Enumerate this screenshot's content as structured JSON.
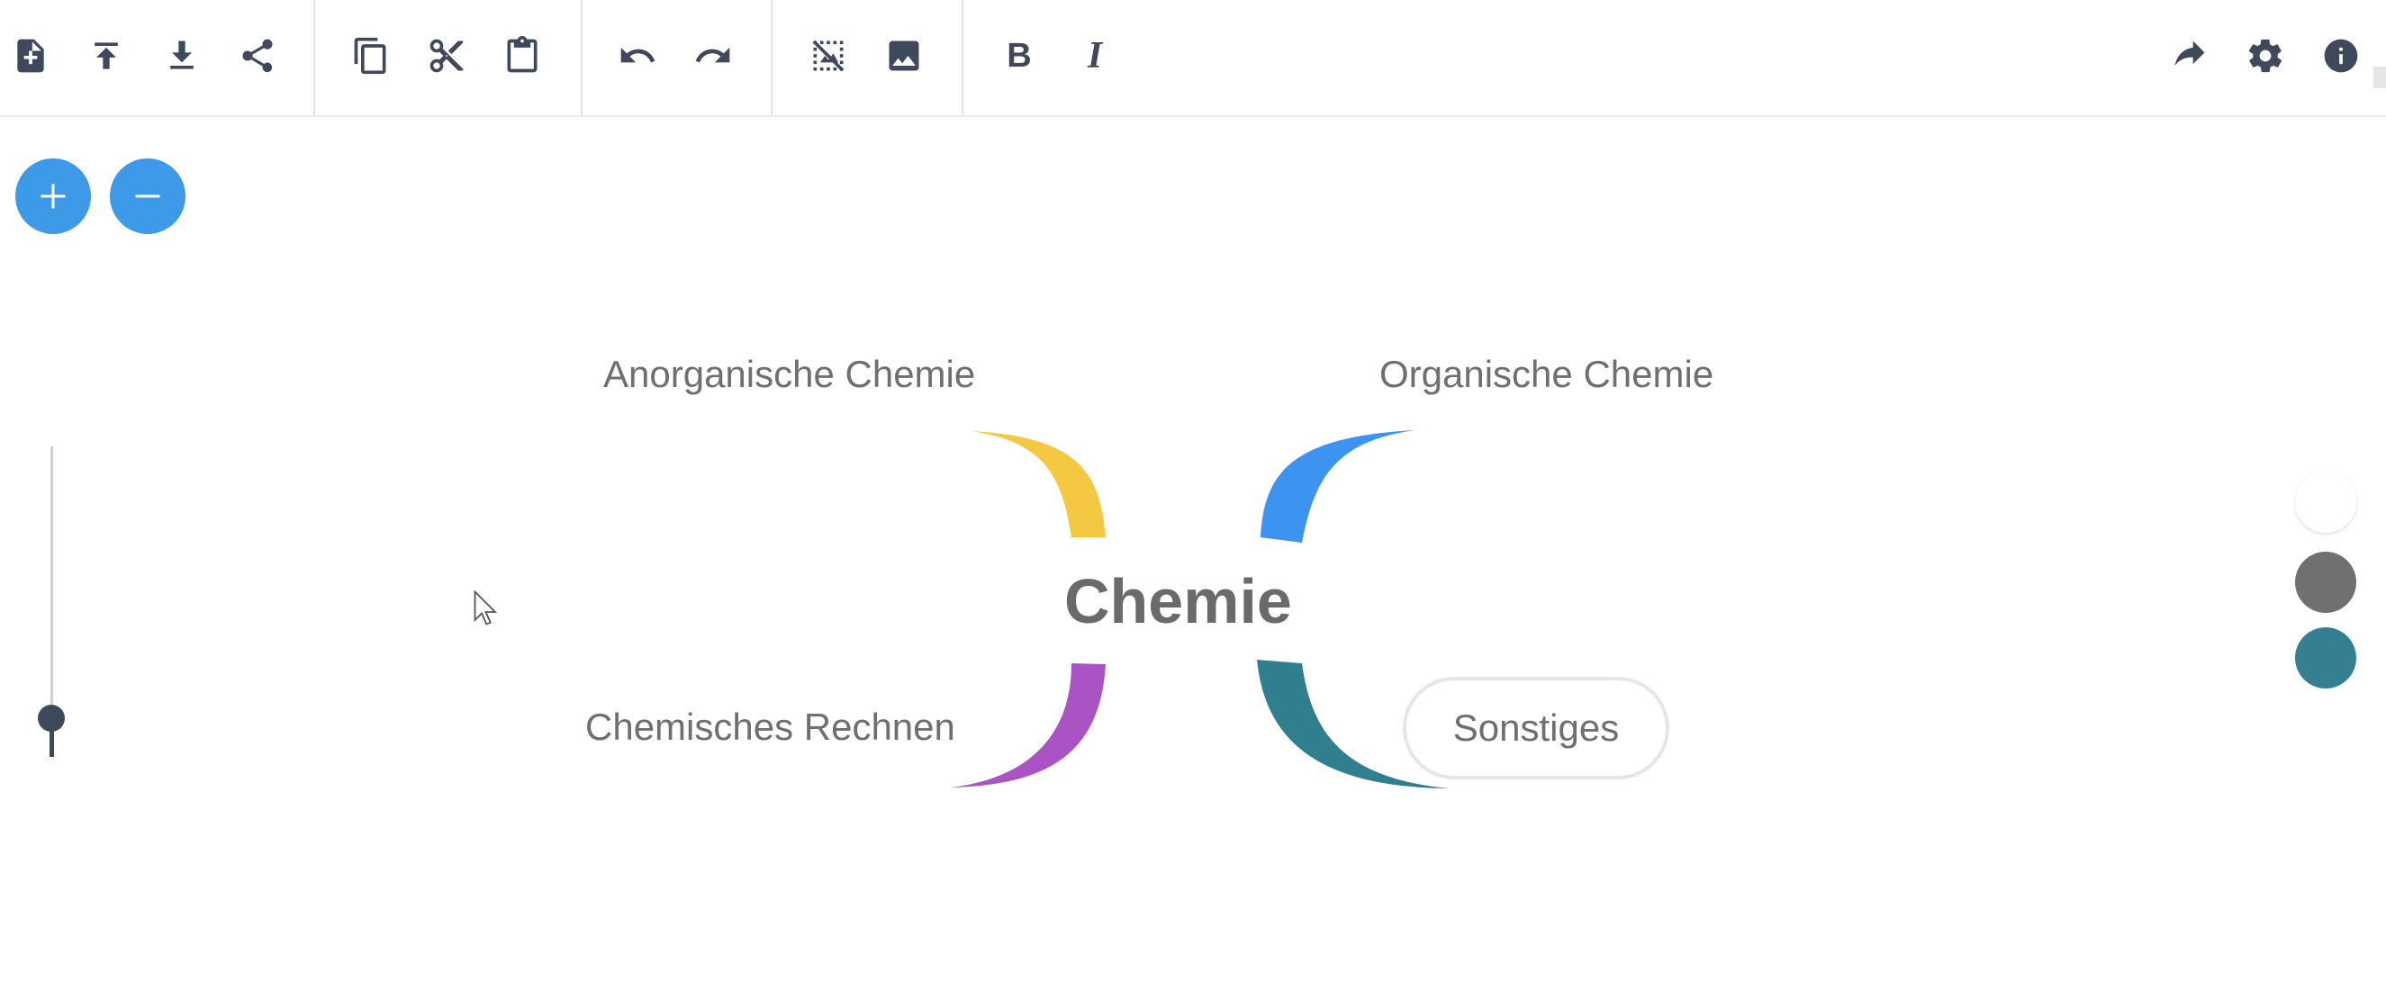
{
  "toolbar": {
    "buttons": [
      {
        "name": "new-file-icon"
      },
      {
        "name": "upload-icon"
      },
      {
        "name": "download-icon"
      },
      {
        "name": "share-icon"
      },
      {
        "name": "copy-icon"
      },
      {
        "name": "cut-icon"
      },
      {
        "name": "paste-icon"
      },
      {
        "name": "undo-icon"
      },
      {
        "name": "redo-icon"
      },
      {
        "name": "no-image-icon"
      },
      {
        "name": "image-icon"
      },
      {
        "name": "bold-icon",
        "label": "B"
      },
      {
        "name": "italic-icon",
        "label": "I"
      },
      {
        "name": "forward-icon"
      },
      {
        "name": "gear-icon"
      },
      {
        "name": "info-icon"
      }
    ]
  },
  "zoom": {
    "in_icon": "plus-icon",
    "out_icon": "minus-icon"
  },
  "mindmap": {
    "root": "Chemie",
    "branches": [
      {
        "label": "Anorganische Chemie",
        "color": "#f5c842"
      },
      {
        "label": "Organische Chemie",
        "color": "#3d94f0"
      },
      {
        "label": "Chemisches Rechnen",
        "color": "#a953c4"
      },
      {
        "label": "Sonstiges",
        "color": "#2f7f8f"
      }
    ]
  },
  "palette": {
    "colors": [
      "#ffffff",
      "#707070",
      "#357f93"
    ]
  }
}
